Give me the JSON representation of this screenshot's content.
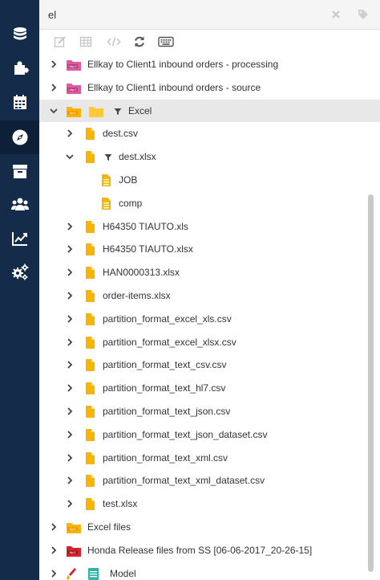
{
  "search": {
    "value": "el"
  },
  "colors": {
    "rail": "#142b4a",
    "folder_yellow": "#f7b500",
    "http_pink": "#e05a9d",
    "ftp_red": "#d8232a",
    "selected_row": "#e8e8e8"
  },
  "rail_items": [
    {
      "name": "database-icon"
    },
    {
      "name": "puzzle-icon"
    },
    {
      "name": "calendar-icon"
    },
    {
      "name": "compass-icon",
      "active": true
    },
    {
      "name": "archive-icon"
    },
    {
      "name": "users-icon"
    },
    {
      "name": "chart-icon"
    },
    {
      "name": "gears-icon"
    }
  ],
  "toolbar": [
    "edit-icon",
    "table-icon",
    "code-icon",
    "refresh-icon",
    "keyboard-icon"
  ],
  "tree": [
    {
      "label": "Ellkay to Client1 inbound orders - processing",
      "icon": "http",
      "chev": "right",
      "level": 0
    },
    {
      "label": "Ellkay to Client1 inbound orders - source",
      "icon": "http",
      "chev": "right",
      "level": 0
    },
    {
      "label": "Excel",
      "icon": "folderpair",
      "chev": "down",
      "level": 0,
      "filter": true,
      "selected": true
    },
    {
      "label": "dest.csv",
      "icon": "file",
      "chev": "right",
      "level": 1
    },
    {
      "label": "dest.xlsx",
      "icon": "file",
      "chev": "down",
      "level": 1,
      "filter": true
    },
    {
      "label": "JOB",
      "icon": "sheet",
      "level": 2
    },
    {
      "label": "comp",
      "icon": "sheet",
      "level": 2
    },
    {
      "label": "H64350 TIAUTO.xls",
      "icon": "file",
      "chev": "right",
      "level": 1
    },
    {
      "label": "H64350 TIAUTO.xlsx",
      "icon": "file",
      "chev": "right",
      "level": 1
    },
    {
      "label": "HAN0000313.xlsx",
      "icon": "file",
      "chev": "right",
      "level": 1
    },
    {
      "label": "order-items.xlsx",
      "icon": "file",
      "chev": "right",
      "level": 1
    },
    {
      "label": "partition_format_excel_xls.csv",
      "icon": "file",
      "chev": "right",
      "level": 1
    },
    {
      "label": "partition_format_excel_xlsx.csv",
      "icon": "file",
      "chev": "right",
      "level": 1
    },
    {
      "label": "partition_format_text_csv.csv",
      "icon": "file",
      "chev": "right",
      "level": 1
    },
    {
      "label": "partition_format_text_hl7.csv",
      "icon": "file",
      "chev": "right",
      "level": 1
    },
    {
      "label": "partition_format_text_json.csv",
      "icon": "file",
      "chev": "right",
      "level": 1
    },
    {
      "label": "partition_format_text_json_dataset.csv",
      "icon": "file",
      "chev": "right",
      "level": 1
    },
    {
      "label": "partition_format_text_xml.csv",
      "icon": "file",
      "chev": "right",
      "level": 1
    },
    {
      "label": "partition_format_text_xml_dataset.csv",
      "icon": "file",
      "chev": "right",
      "level": 1
    },
    {
      "label": "test.xlsx",
      "icon": "file",
      "chev": "right",
      "level": 1
    },
    {
      "label": "Excel files",
      "icon": "folder",
      "chev": "right",
      "level": 0
    },
    {
      "label": "Honda Release files from SS [06-06-2017_20-26-15]",
      "icon": "ftp",
      "chev": "right",
      "level": 0
    },
    {
      "label": "Model",
      "icon": "brushsheet",
      "chev": "right",
      "level": 0
    }
  ]
}
